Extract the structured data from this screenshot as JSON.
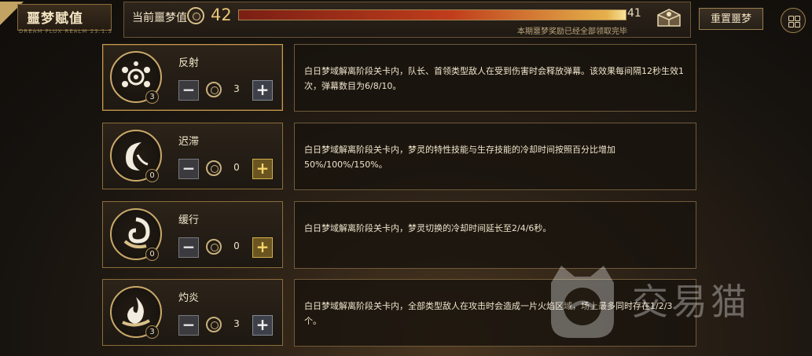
{
  "header": {
    "title": "噩梦赋值",
    "subtitle": "DREAM FLUX REALM 23.1.3",
    "value_label": "当前噩梦值",
    "value_current": "42",
    "value_max": "41",
    "progress": 1.0,
    "reward_note": "本期噩梦奖励已经全部领取完毕",
    "reset_label": "重置噩梦"
  },
  "icons": {
    "currency": "nightmare-coin-icon",
    "chest": "treasure-chest-icon",
    "menu": "grid-menu-icon"
  },
  "skills": [
    {
      "name": "反射",
      "level": "3",
      "count": "3",
      "plus_active": false,
      "description": "白日梦域解离阶段关卡内，队长、首领类型敌人在受到伤害时会释放弹幕。该效果每间隔12秒生效1次，弹幕数目为6/8/10。"
    },
    {
      "name": "迟滞",
      "level": "0",
      "count": "0",
      "plus_active": true,
      "description": "白日梦域解离阶段关卡内，梦灵的特性技能与生存技能的冷却时间按照百分比增加50%/100%/150%。"
    },
    {
      "name": "缓行",
      "level": "0",
      "count": "0",
      "plus_active": true,
      "description": "白日梦域解离阶段关卡内，梦灵切换的冷却时间延长至2/4/6秒。"
    },
    {
      "name": "灼炎",
      "level": "3",
      "count": "3",
      "plus_active": false,
      "description": "白日梦域解离阶段关卡内，全部类型敌人在攻击时会造成一片火焰区域，场上最多同时存在1/2/3个。"
    }
  ],
  "buttons": {
    "minus": "−",
    "plus": "+"
  },
  "watermark": "交易猫"
}
